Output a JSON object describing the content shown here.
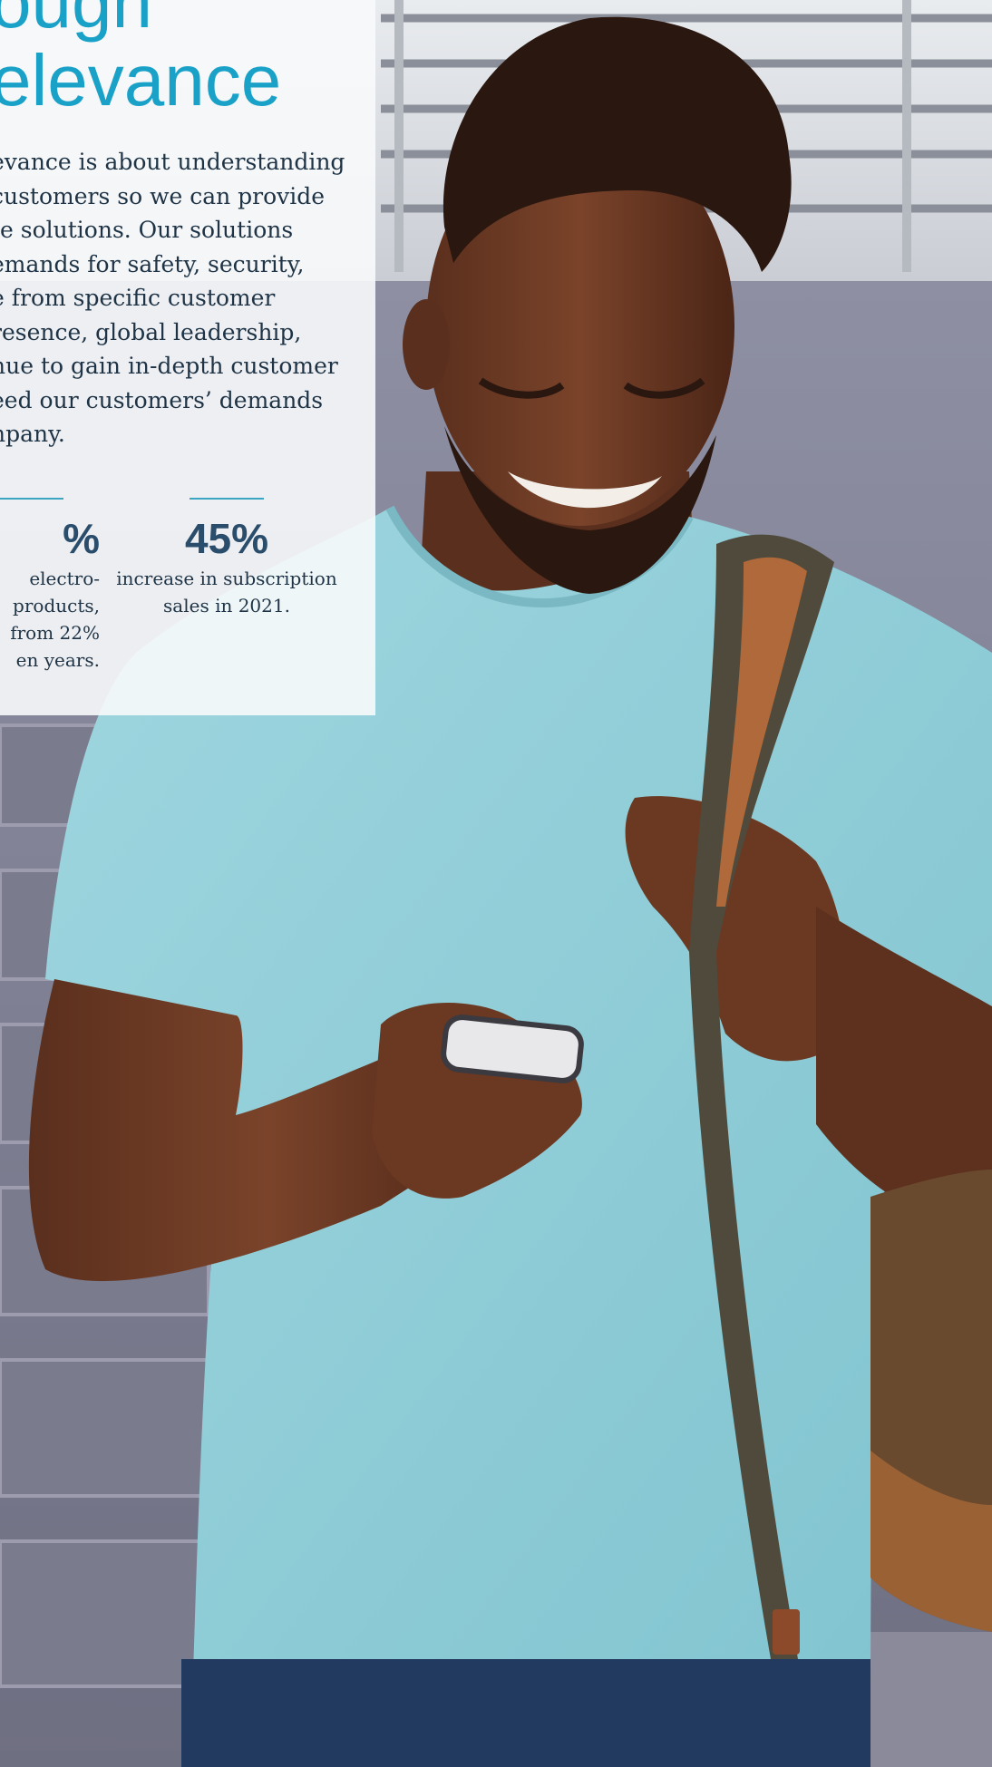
{
  "page": {
    "heading_lines": [
      "ough",
      "elevance"
    ],
    "body_lines": [
      "evance is about understanding",
      "customers so we can provide",
      "te solutions. Our solutions",
      "emands for safety, security,",
      "e from specific customer",
      "resence, global leadership,",
      "nue to gain in-depth customer",
      "eed our customers’ demands",
      "npany."
    ],
    "stats": [
      {
        "value": "%",
        "caption_lines": [
          "electro-",
          "products,",
          "from 22%",
          "en years."
        ]
      },
      {
        "value": "45%",
        "caption_lines": [
          "increase in subscription",
          "sales in 2021."
        ]
      }
    ]
  },
  "colors": {
    "heading": "#1aa1c8",
    "body_text": "#1e3446",
    "stat_value": "#2a4d6b",
    "accent_rule": "#3aa6c4",
    "panel_bg": "#f8f9fb"
  }
}
